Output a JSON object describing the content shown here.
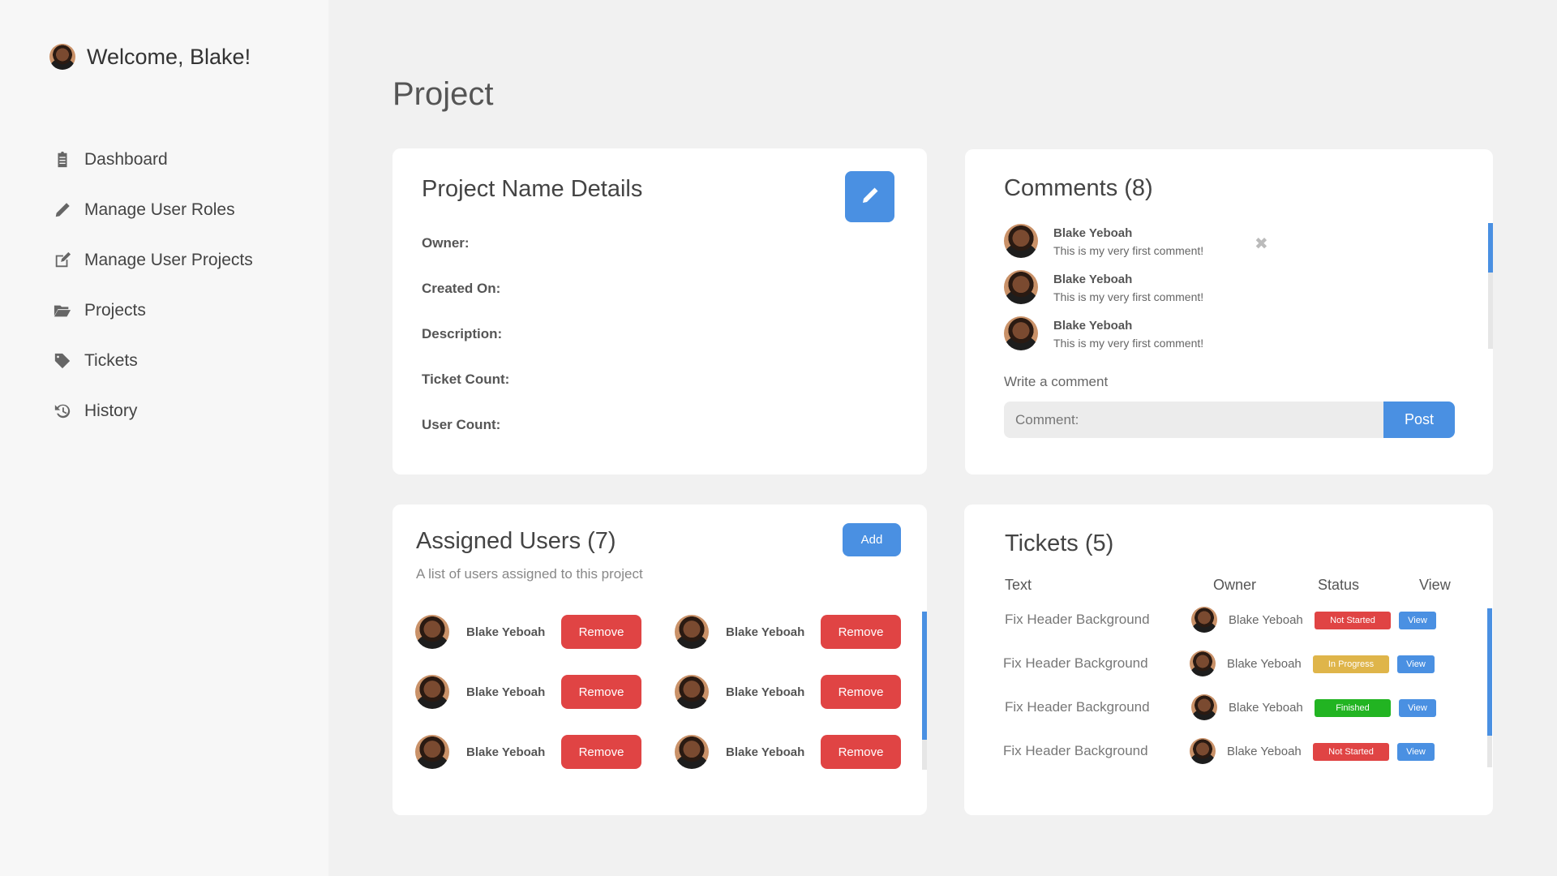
{
  "sidebar": {
    "welcome": "Welcome, Blake!",
    "items": [
      {
        "label": "Dashboard",
        "icon": "clipboard-icon"
      },
      {
        "label": "Manage User Roles",
        "icon": "pencil-icon"
      },
      {
        "label": "Manage User Projects",
        "icon": "edit-icon"
      },
      {
        "label": "Projects",
        "icon": "folder-open-icon"
      },
      {
        "label": "Tickets",
        "icon": "tag-icon"
      },
      {
        "label": "History",
        "icon": "history-icon"
      }
    ]
  },
  "page": {
    "title": "Project"
  },
  "details": {
    "title": "Project Name Details",
    "owner_label": "Owner:",
    "created_label": "Created On:",
    "description_label": "Description:",
    "ticket_count_label": "Ticket Count:",
    "user_count_label": "User Count:"
  },
  "comments": {
    "title": "Comments (8)",
    "items": [
      {
        "author": "Blake Yeboah",
        "text": "This is my very first comment!"
      },
      {
        "author": "Blake Yeboah",
        "text": "This is my very first comment!"
      },
      {
        "author": "Blake Yeboah",
        "text": "This is my very first comment!"
      }
    ],
    "close_glyph": "✖",
    "write_label": "Write a comment",
    "input_placeholder": "Comment:",
    "post_label": "Post"
  },
  "users": {
    "title": "Assigned Users (7)",
    "subtitle": "A list of users assigned to this project",
    "add_label": "Add",
    "remove_label": "Remove",
    "items": [
      {
        "name": "Blake Yeboah"
      },
      {
        "name": "Blake Yeboah"
      },
      {
        "name": "Blake Yeboah"
      },
      {
        "name": "Blake Yeboah"
      },
      {
        "name": "Blake Yeboah"
      },
      {
        "name": "Blake Yeboah"
      }
    ]
  },
  "tickets": {
    "title": "Tickets (5)",
    "columns": [
      "Text",
      "Owner",
      "Status",
      "View"
    ],
    "view_label": "View",
    "rows": [
      {
        "text": "Fix Header Background",
        "owner": "Blake Yeboah",
        "status": "Not Started"
      },
      {
        "text": "Fix Header Background",
        "owner": "Blake Yeboah",
        "status": "In Progress"
      },
      {
        "text": "Fix Header Background",
        "owner": "Blake Yeboah",
        "status": "Finished"
      },
      {
        "text": "Fix Header Background",
        "owner": "Blake Yeboah",
        "status": "Not Started"
      }
    ]
  },
  "colors": {
    "accent": "#4a90e2",
    "danger": "#e04444",
    "not_started": "#e04444",
    "in_progress": "#dfb54a",
    "finished": "#22b422"
  }
}
